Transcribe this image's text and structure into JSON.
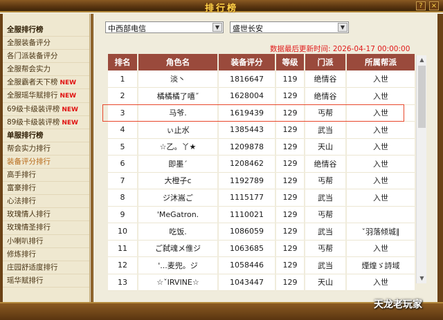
{
  "window": {
    "title": "排行榜",
    "help": "?",
    "close": "×"
  },
  "sidebar": {
    "items": [
      {
        "label": "全服排行榜",
        "type": "head"
      },
      {
        "label": "全服装备评分"
      },
      {
        "label": "各门派装备评分"
      },
      {
        "label": "全服帮会实力"
      },
      {
        "label": "全服霸者天下榜",
        "badge": "NEW"
      },
      {
        "label": "全服瑶华赋排行",
        "badge": "NEW"
      },
      {
        "label": "69级卡级装评榜",
        "badge": "NEW"
      },
      {
        "label": "89级卡级装评榜",
        "badge": "NEW"
      },
      {
        "label": "单服排行榜",
        "type": "head"
      },
      {
        "label": "帮会实力排行"
      },
      {
        "label": "装备评分排行",
        "active": true
      },
      {
        "label": "高手排行"
      },
      {
        "label": "富豪排行"
      },
      {
        "label": "心法排行"
      },
      {
        "label": "玫瑰情人排行"
      },
      {
        "label": "玫瑰情圣排行"
      },
      {
        "label": "小喇叭排行"
      },
      {
        "label": "修炼排行"
      },
      {
        "label": "庄园舒适度排行"
      },
      {
        "label": "瑶华赋排行"
      }
    ]
  },
  "filters": {
    "region": "中西部电信",
    "server": "盛世长安"
  },
  "updated": "数据最后更新时间:  2026-04-17 00:00:00",
  "table": {
    "headers": [
      "排名",
      "角色名",
      "装备评分",
      "等级",
      "门派",
      "所属帮派"
    ],
    "rows": [
      [
        "1",
        "淡丶",
        "1816647",
        "119",
        "绝情谷",
        "入世"
      ],
      [
        "2",
        "橘橘橘了嘻˝",
        "1628004",
        "129",
        "绝情谷",
        "入世"
      ],
      [
        "3",
        "马爷.",
        "1619439",
        "129",
        "丐帮",
        "入世"
      ],
      [
        "4",
        "ぃ止水゙",
        "1385443",
        "129",
        "武当",
        "入世"
      ],
      [
        "5",
        "☆乙。丫★",
        "1209878",
        "129",
        "天山",
        "入世"
      ],
      [
        "6",
        "即墨´",
        "1208462",
        "129",
        "绝情谷",
        "入世"
      ],
      [
        "7",
        "大橙子c",
        "1192789",
        "129",
        "丐帮",
        "入世"
      ],
      [
        "8",
        "ジ沐嵩ご",
        "1115177",
        "129",
        "武当",
        "入世"
      ],
      [
        "9",
        "'MeGatron.",
        "1110021",
        "129",
        "丐帮",
        ""
      ],
      [
        "10",
        "吃饭.",
        "1086059",
        "129",
        "武当",
        "ˇ羽落倾城∥"
      ],
      [
        "11",
        "ご弑魂メ倠ジ",
        "1063685",
        "129",
        "丐帮",
        "入世"
      ],
      [
        "12",
        "'...麦兜。ジ",
        "1058446",
        "129",
        "武当",
        "煙煌ゞ詩域"
      ],
      [
        "13",
        "☆ˇIRVINE☆",
        "1043447",
        "129",
        "天山",
        "入世"
      ]
    ]
  },
  "watermark": "天龙老玩家",
  "colors": {
    "header_bg": "#9a4a3c",
    "highlight": "#e8462a",
    "timestamp": "#e01818",
    "badge": "#e01010"
  }
}
